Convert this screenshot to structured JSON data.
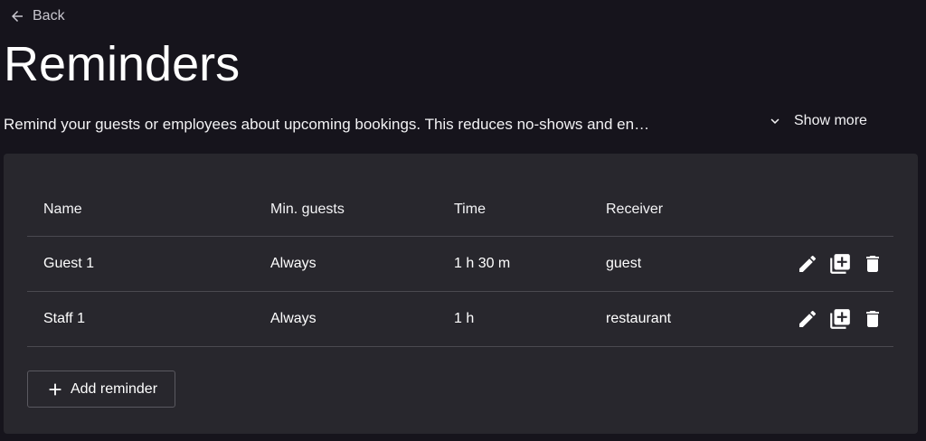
{
  "nav": {
    "back_label": "Back",
    "back_icon": "arrow-left-icon"
  },
  "page": {
    "title": "Reminders",
    "description": "Remind your guests or employees about upcoming bookings. This reduces no-shows and en…",
    "show_more_label": "Show more"
  },
  "table": {
    "columns": {
      "name": "Name",
      "min_guests": "Min. guests",
      "time": "Time",
      "receiver": "Receiver"
    },
    "rows": [
      {
        "name": "Guest 1",
        "min_guests": "Always",
        "time": "1 h 30 m",
        "receiver": "guest"
      },
      {
        "name": "Staff 1",
        "min_guests": "Always",
        "time": "1 h",
        "receiver": "restaurant"
      }
    ],
    "row_actions": [
      "edit-icon",
      "duplicate-icon",
      "delete-icon"
    ]
  },
  "actions": {
    "add_reminder_label": "Add reminder"
  },
  "colors": {
    "background": "#16141c",
    "card": "#28272d",
    "divider": "#4a4950",
    "text": "#ffffff",
    "muted_text": "#c9c7cf"
  }
}
